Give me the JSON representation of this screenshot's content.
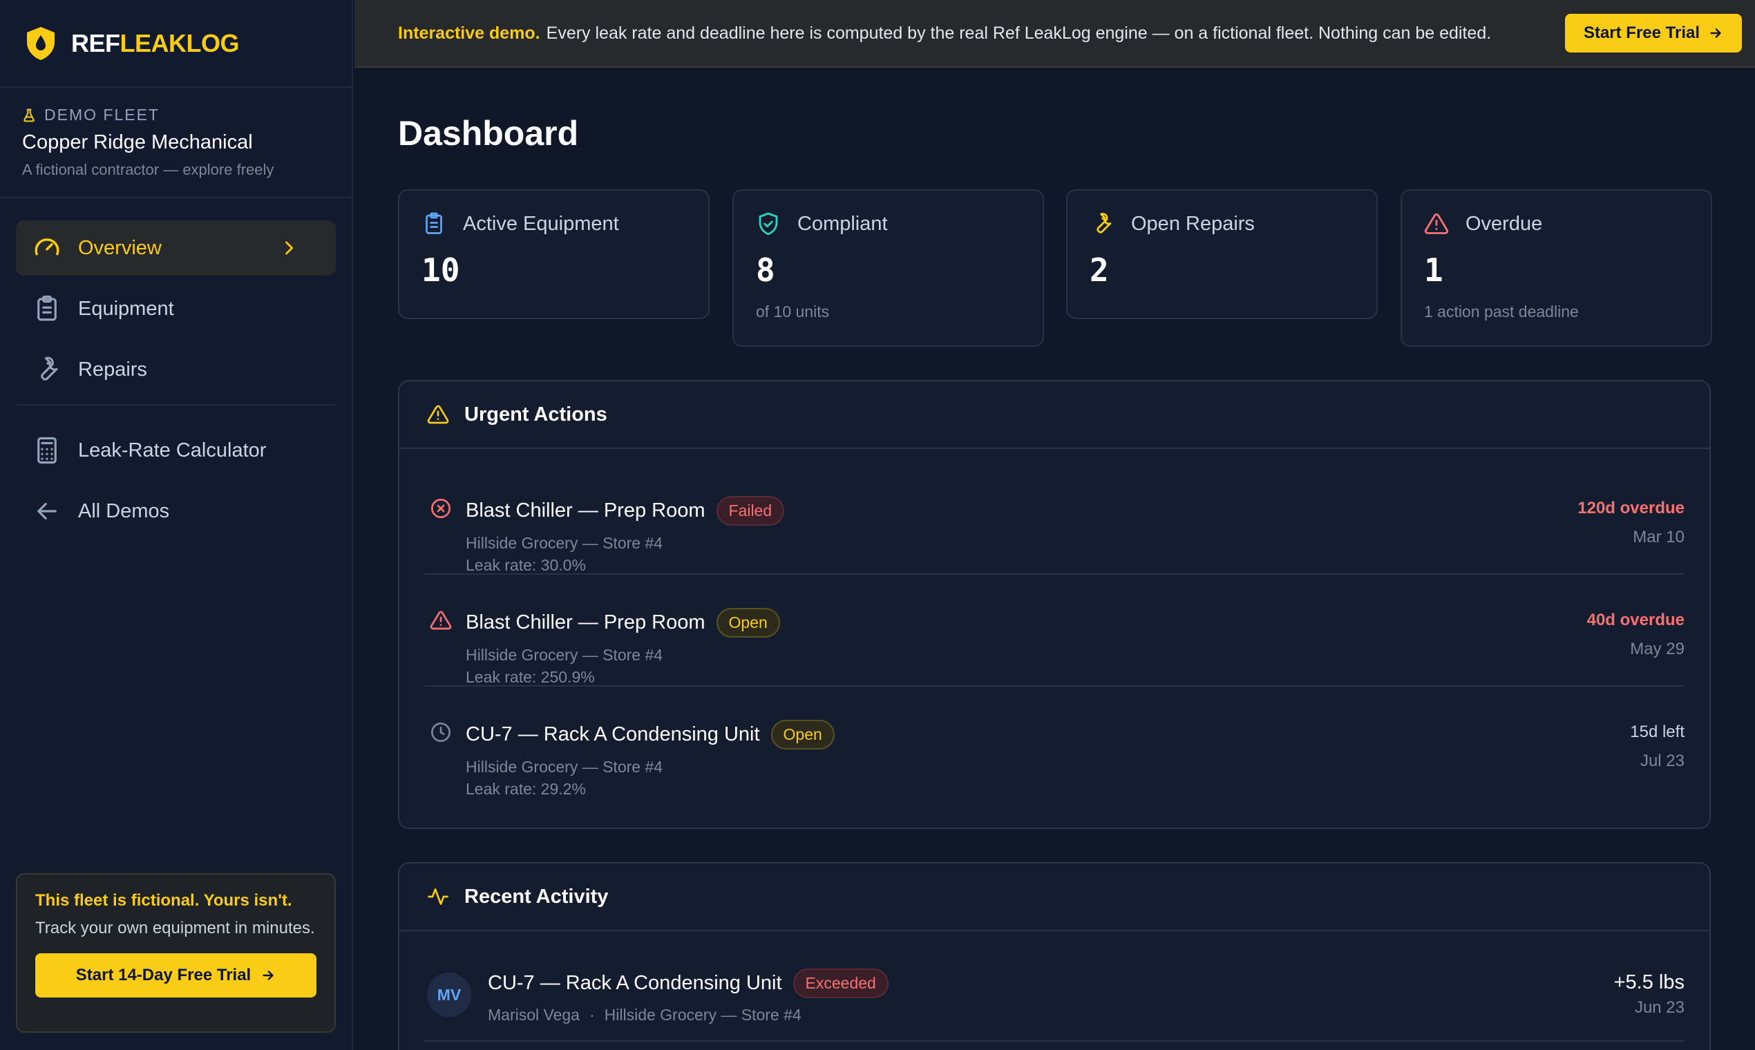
{
  "brand": {
    "prefix": "REF",
    "suffix": "LEAKLOG"
  },
  "fleet": {
    "tag": "DEMO FLEET",
    "name": "Copper Ridge Mechanical",
    "subtitle": "A fictional contractor — explore freely"
  },
  "nav": {
    "overview": "Overview",
    "equipment": "Equipment",
    "repairs": "Repairs",
    "calculator": "Leak-Rate Calculator",
    "all_demos": "All Demos"
  },
  "promo": {
    "title": "This fleet is fictional. Yours isn't.",
    "text": "Track your own equipment in minutes.",
    "button": "Start 14-Day Free Trial"
  },
  "banner": {
    "strong": "Interactive demo.",
    "text": "Every leak rate and deadline here is computed by the real Ref LeakLog engine — on a fictional fleet. Nothing can be edited.",
    "button": "Start Free Trial"
  },
  "page": {
    "title": "Dashboard"
  },
  "stats": [
    {
      "label": "Active Equipment",
      "value": "10",
      "sub": ""
    },
    {
      "label": "Compliant",
      "value": "8",
      "sub": "of 10 units"
    },
    {
      "label": "Open Repairs",
      "value": "2",
      "sub": ""
    },
    {
      "label": "Overdue",
      "value": "1",
      "sub": "1 action past deadline"
    }
  ],
  "urgent": {
    "title": "Urgent Actions",
    "items": [
      {
        "title": "Blast Chiller — Prep Room",
        "status": "Failed",
        "site": "Hillside Grocery — Store #4",
        "leak": "Leak rate: 30.0%",
        "due": "120d overdue",
        "date": "Mar 10"
      },
      {
        "title": "Blast Chiller — Prep Room",
        "status": "Open",
        "site": "Hillside Grocery — Store #4",
        "leak": "Leak rate: 250.9%",
        "due": "40d overdue",
        "date": "May 29"
      },
      {
        "title": "CU-7 — Rack A Condensing Unit",
        "status": "Open",
        "site": "Hillside Grocery — Store #4",
        "leak": "Leak rate: 29.2%",
        "due": "15d left",
        "date": "Jul 23"
      }
    ]
  },
  "activity": {
    "title": "Recent Activity",
    "items": [
      {
        "initials": "MV",
        "title": "CU-7 — Rack A Condensing Unit",
        "status": "Exceeded",
        "user": "Marisol Vega",
        "site": "Hillside Grocery — Store #4",
        "amount": "+5.5 lbs",
        "date": "Jun 23"
      }
    ]
  },
  "colors": {
    "accent": "#facc15",
    "danger": "#f87171",
    "background": "#0f1729",
    "card": "#141d30"
  }
}
